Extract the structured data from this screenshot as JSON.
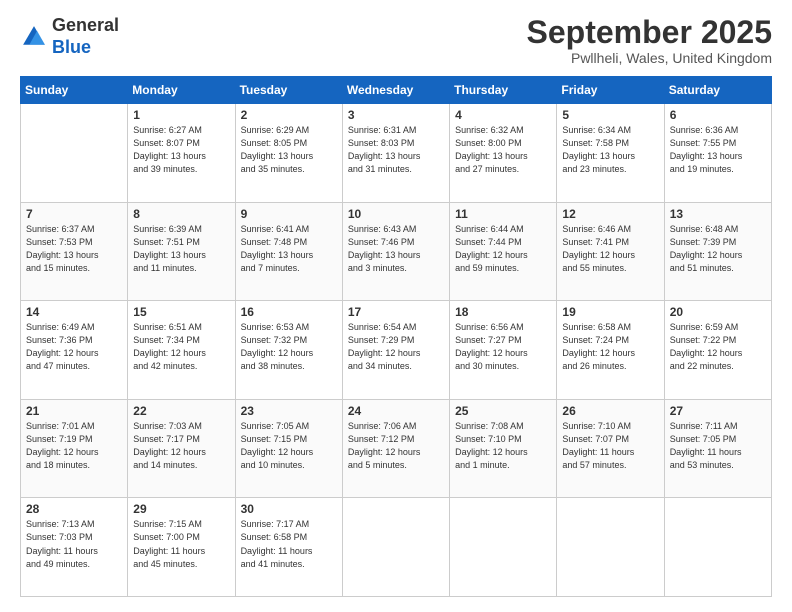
{
  "header": {
    "logo_general": "General",
    "logo_blue": "Blue",
    "month_title": "September 2025",
    "location": "Pwllheli, Wales, United Kingdom"
  },
  "days_of_week": [
    "Sunday",
    "Monday",
    "Tuesday",
    "Wednesday",
    "Thursday",
    "Friday",
    "Saturday"
  ],
  "weeks": [
    [
      {
        "day": "",
        "info": ""
      },
      {
        "day": "1",
        "info": "Sunrise: 6:27 AM\nSunset: 8:07 PM\nDaylight: 13 hours\nand 39 minutes."
      },
      {
        "day": "2",
        "info": "Sunrise: 6:29 AM\nSunset: 8:05 PM\nDaylight: 13 hours\nand 35 minutes."
      },
      {
        "day": "3",
        "info": "Sunrise: 6:31 AM\nSunset: 8:03 PM\nDaylight: 13 hours\nand 31 minutes."
      },
      {
        "day": "4",
        "info": "Sunrise: 6:32 AM\nSunset: 8:00 PM\nDaylight: 13 hours\nand 27 minutes."
      },
      {
        "day": "5",
        "info": "Sunrise: 6:34 AM\nSunset: 7:58 PM\nDaylight: 13 hours\nand 23 minutes."
      },
      {
        "day": "6",
        "info": "Sunrise: 6:36 AM\nSunset: 7:55 PM\nDaylight: 13 hours\nand 19 minutes."
      }
    ],
    [
      {
        "day": "7",
        "info": "Sunrise: 6:37 AM\nSunset: 7:53 PM\nDaylight: 13 hours\nand 15 minutes."
      },
      {
        "day": "8",
        "info": "Sunrise: 6:39 AM\nSunset: 7:51 PM\nDaylight: 13 hours\nand 11 minutes."
      },
      {
        "day": "9",
        "info": "Sunrise: 6:41 AM\nSunset: 7:48 PM\nDaylight: 13 hours\nand 7 minutes."
      },
      {
        "day": "10",
        "info": "Sunrise: 6:43 AM\nSunset: 7:46 PM\nDaylight: 13 hours\nand 3 minutes."
      },
      {
        "day": "11",
        "info": "Sunrise: 6:44 AM\nSunset: 7:44 PM\nDaylight: 12 hours\nand 59 minutes."
      },
      {
        "day": "12",
        "info": "Sunrise: 6:46 AM\nSunset: 7:41 PM\nDaylight: 12 hours\nand 55 minutes."
      },
      {
        "day": "13",
        "info": "Sunrise: 6:48 AM\nSunset: 7:39 PM\nDaylight: 12 hours\nand 51 minutes."
      }
    ],
    [
      {
        "day": "14",
        "info": "Sunrise: 6:49 AM\nSunset: 7:36 PM\nDaylight: 12 hours\nand 47 minutes."
      },
      {
        "day": "15",
        "info": "Sunrise: 6:51 AM\nSunset: 7:34 PM\nDaylight: 12 hours\nand 42 minutes."
      },
      {
        "day": "16",
        "info": "Sunrise: 6:53 AM\nSunset: 7:32 PM\nDaylight: 12 hours\nand 38 minutes."
      },
      {
        "day": "17",
        "info": "Sunrise: 6:54 AM\nSunset: 7:29 PM\nDaylight: 12 hours\nand 34 minutes."
      },
      {
        "day": "18",
        "info": "Sunrise: 6:56 AM\nSunset: 7:27 PM\nDaylight: 12 hours\nand 30 minutes."
      },
      {
        "day": "19",
        "info": "Sunrise: 6:58 AM\nSunset: 7:24 PM\nDaylight: 12 hours\nand 26 minutes."
      },
      {
        "day": "20",
        "info": "Sunrise: 6:59 AM\nSunset: 7:22 PM\nDaylight: 12 hours\nand 22 minutes."
      }
    ],
    [
      {
        "day": "21",
        "info": "Sunrise: 7:01 AM\nSunset: 7:19 PM\nDaylight: 12 hours\nand 18 minutes."
      },
      {
        "day": "22",
        "info": "Sunrise: 7:03 AM\nSunset: 7:17 PM\nDaylight: 12 hours\nand 14 minutes."
      },
      {
        "day": "23",
        "info": "Sunrise: 7:05 AM\nSunset: 7:15 PM\nDaylight: 12 hours\nand 10 minutes."
      },
      {
        "day": "24",
        "info": "Sunrise: 7:06 AM\nSunset: 7:12 PM\nDaylight: 12 hours\nand 5 minutes."
      },
      {
        "day": "25",
        "info": "Sunrise: 7:08 AM\nSunset: 7:10 PM\nDaylight: 12 hours\nand 1 minute."
      },
      {
        "day": "26",
        "info": "Sunrise: 7:10 AM\nSunset: 7:07 PM\nDaylight: 11 hours\nand 57 minutes."
      },
      {
        "day": "27",
        "info": "Sunrise: 7:11 AM\nSunset: 7:05 PM\nDaylight: 11 hours\nand 53 minutes."
      }
    ],
    [
      {
        "day": "28",
        "info": "Sunrise: 7:13 AM\nSunset: 7:03 PM\nDaylight: 11 hours\nand 49 minutes."
      },
      {
        "day": "29",
        "info": "Sunrise: 7:15 AM\nSunset: 7:00 PM\nDaylight: 11 hours\nand 45 minutes."
      },
      {
        "day": "30",
        "info": "Sunrise: 7:17 AM\nSunset: 6:58 PM\nDaylight: 11 hours\nand 41 minutes."
      },
      {
        "day": "",
        "info": ""
      },
      {
        "day": "",
        "info": ""
      },
      {
        "day": "",
        "info": ""
      },
      {
        "day": "",
        "info": ""
      }
    ]
  ]
}
